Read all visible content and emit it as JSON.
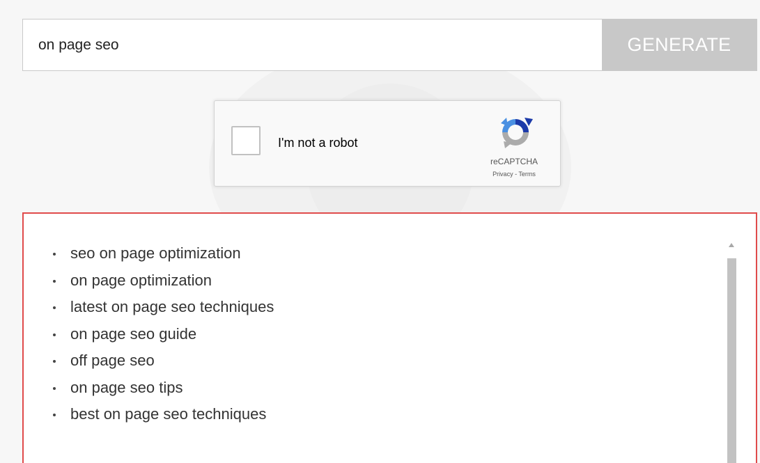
{
  "search": {
    "value": "on page seo",
    "button_label": "GENERATE"
  },
  "recaptcha": {
    "label": "I'm not a robot",
    "brand": "reCAPTCHA",
    "privacy": "Privacy",
    "separator": " - ",
    "terms": "Terms"
  },
  "results": {
    "items": [
      "seo on page optimization",
      "on page optimization",
      "latest on page seo techniques",
      "on page seo guide",
      "off page seo",
      "on page seo tips",
      "best on page seo techniques"
    ]
  },
  "icons": {
    "recaptcha_logo": "recaptcha-logo-icon",
    "scroll_up": "scroll-up-arrow-icon"
  },
  "colors": {
    "accent_border": "#e04b4b",
    "button_bg": "#c8c8c8",
    "recaptcha_blue": "#1c3aa9",
    "recaptcha_light_blue": "#4a90e2",
    "recaptcha_gray": "#ababab"
  }
}
